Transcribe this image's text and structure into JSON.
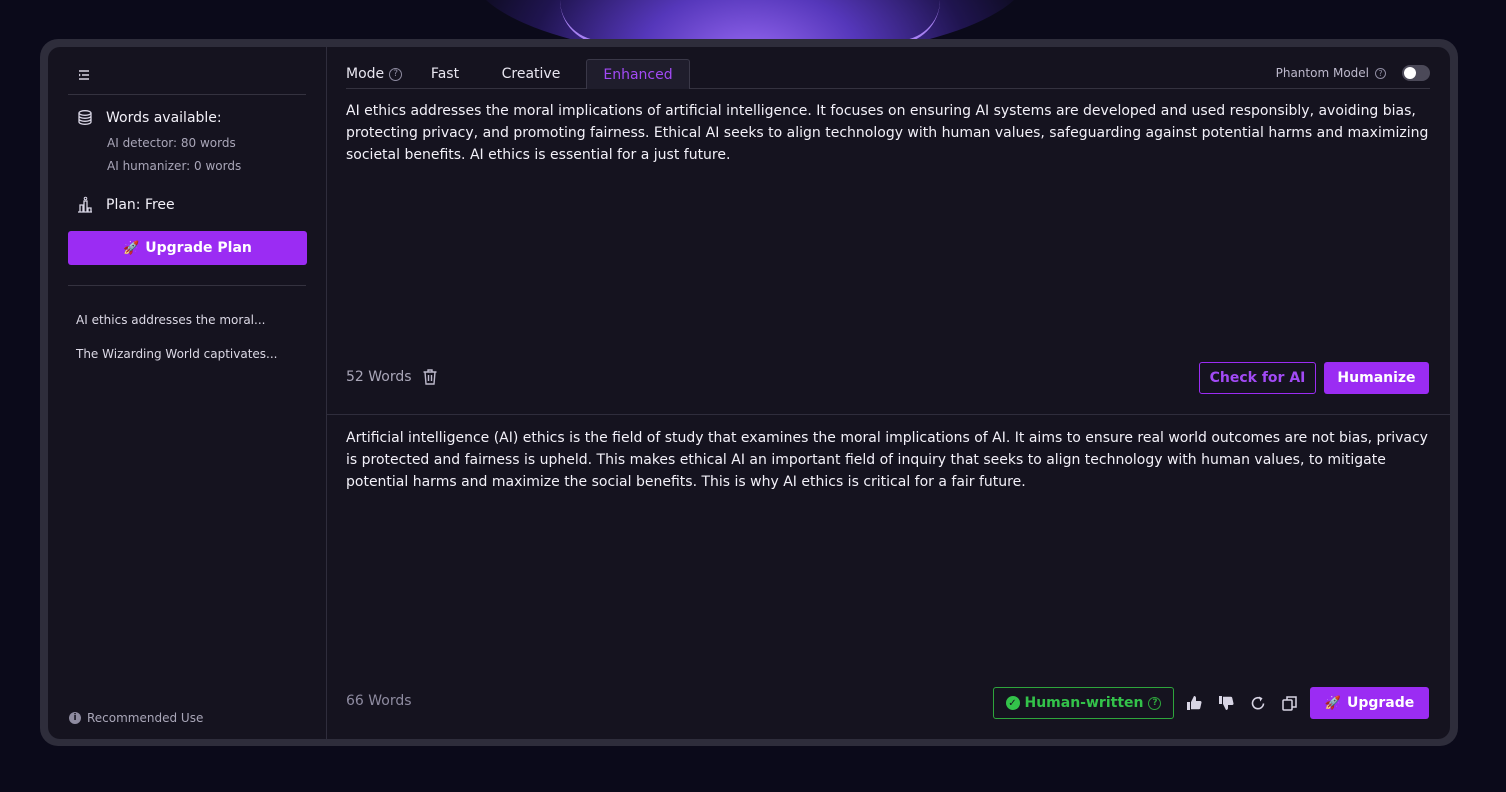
{
  "sidebar": {
    "words_available_label": "Words available:",
    "ai_detector": "AI detector: 80 words",
    "ai_humanizer": "AI humanizer: 0 words",
    "plan": "Plan: Free",
    "upgrade_plan_label": "Upgrade Plan",
    "history": [
      "AI ethics addresses the moral...",
      "The Wizarding World captivates..."
    ],
    "recommended_use": "Recommended Use"
  },
  "modebar": {
    "mode_label": "Mode",
    "tabs": [
      "Fast",
      "Creative",
      "Enhanced"
    ],
    "active_tab": "Enhanced",
    "phantom_label": "Phantom Model"
  },
  "input": {
    "text": "AI ethics addresses the moral implications of artificial intelligence. It focuses on ensuring AI systems are developed and used responsibly, avoiding bias, protecting privacy, and promoting fairness. Ethical AI seeks to align technology with human values, safeguarding against potential harms and maximizing societal benefits. AI ethics is essential for a just future.",
    "word_count": "52 Words",
    "check_label": "Check for AI",
    "humanize_label": "Humanize"
  },
  "output": {
    "text": "Artificial intelligence (AI) ethics is the field of study that examines the moral implications  of AI. It  aims to ensure real world outcomes are not bias, privacy is protected and fairness is upheld. This makes ethical AI an important field of inquiry that seeks to align technology with human values, to mitigate potential harms  and maximize the social benefits. This is why AI ethics is critical  for a fair future.",
    "word_count": "66 Words",
    "badge_label": "Human-written",
    "upgrade_label": "Upgrade"
  },
  "colors": {
    "accent": "#9b2cf3",
    "success": "#33c24a",
    "background": "#15131f"
  }
}
